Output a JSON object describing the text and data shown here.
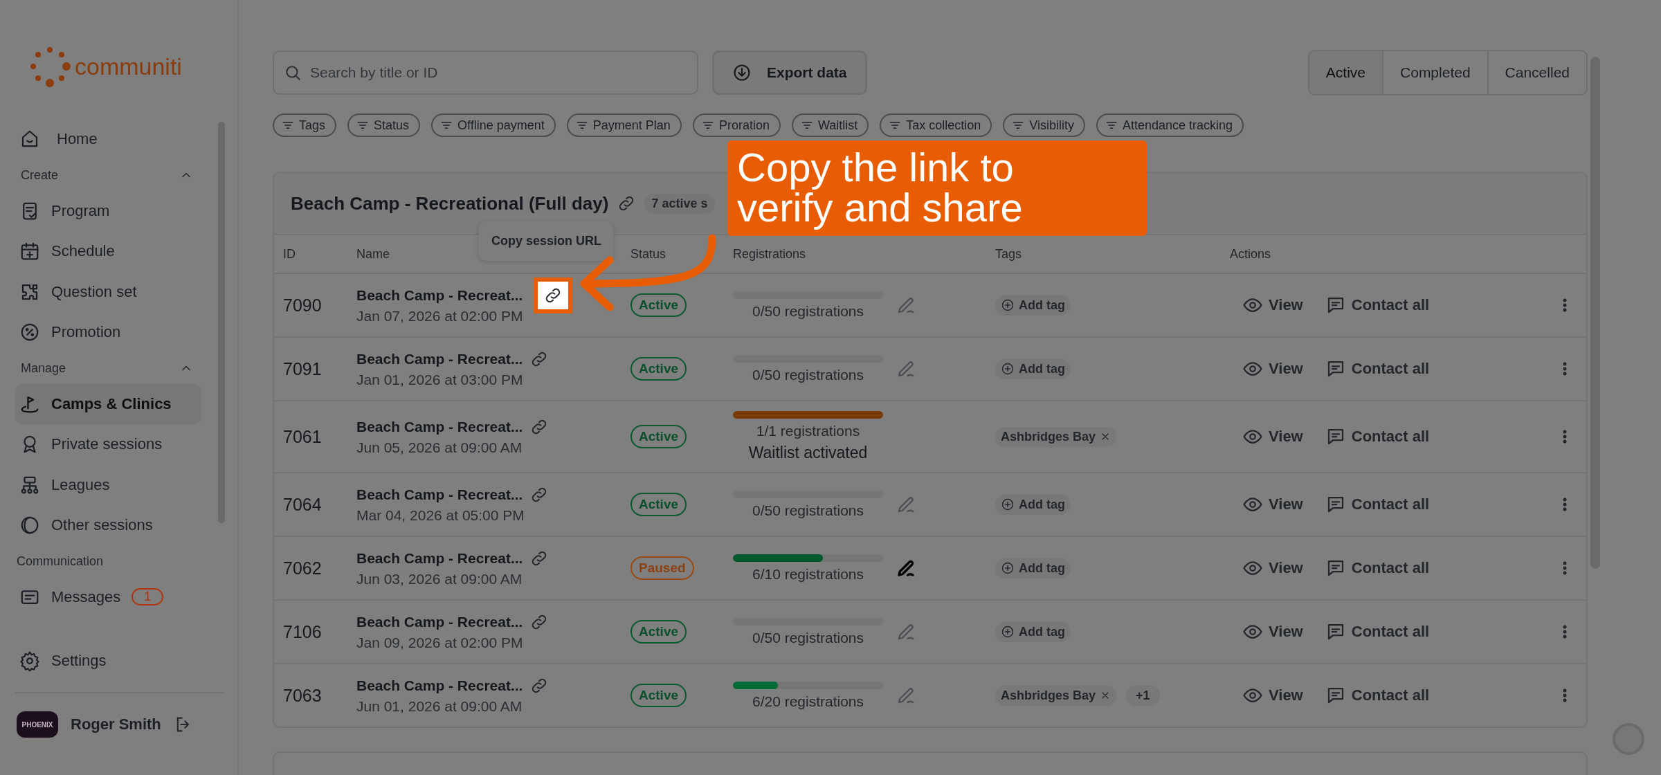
{
  "sidebar": {
    "logo": "communiti",
    "sections": [
      {
        "items": [
          {
            "label": "Home",
            "selected": false
          }
        ]
      },
      {
        "heading": "Create",
        "expanded": true,
        "items": [
          {
            "label": "Program",
            "selected": false
          },
          {
            "label": "Schedule",
            "selected": false
          },
          {
            "label": "Question set",
            "selected": false
          },
          {
            "label": "Promotion",
            "selected": false
          }
        ]
      },
      {
        "heading": "Manage",
        "expanded": true,
        "items": [
          {
            "label": "Camps & Clinics",
            "selected": true
          },
          {
            "label": "Private sessions",
            "selected": false
          },
          {
            "label": "Leagues",
            "selected": false
          },
          {
            "label": "Other sessions",
            "selected": false
          }
        ]
      },
      {
        "heading": "Communication",
        "items": [
          {
            "label": "Messages",
            "selected": false,
            "badge": "1"
          }
        ]
      }
    ],
    "settings": "Settings",
    "user": {
      "name": "Roger Smith",
      "avatar_text": "PHOENIX"
    }
  },
  "search": {
    "placeholder": "Search by title or ID"
  },
  "export_button": "Export data",
  "status_tabs": [
    {
      "label": "Active",
      "selected": true
    },
    {
      "label": "Completed",
      "selected": false
    },
    {
      "label": "Cancelled",
      "selected": false
    }
  ],
  "filters": [
    "Tags",
    "Status",
    "Offline payment",
    "Payment Plan",
    "Proration",
    "Waitlist",
    "Tax collection",
    "Visibility",
    "Attendance tracking"
  ],
  "program": {
    "title": "Beach Camp - Recreational (Full day)",
    "badge": "7 active s",
    "columns": [
      "ID",
      "Name",
      "Status",
      "Registrations",
      "Tags",
      "Actions"
    ],
    "rows": [
      {
        "id": "7090",
        "name": "Beach Camp - Recreat...",
        "date": "Jan 07, 2026 at 02:00 PM",
        "spotlight": true,
        "status": {
          "label": "Active",
          "kind": "active"
        },
        "registrations": {
          "level": 0,
          "text": "0/50 registrations",
          "editable": true,
          "edit_emphasis": false
        },
        "tags": [
          {
            "kind": "add",
            "label": "Add tag"
          }
        ],
        "view": "View",
        "contact": "Contact all"
      },
      {
        "id": "7091",
        "name": "Beach Camp - Recreat...",
        "date": "Jan 01, 2026 at 03:00 PM",
        "spotlight": false,
        "status": {
          "label": "Active",
          "kind": "active"
        },
        "registrations": {
          "level": 0,
          "text": "0/50 registrations",
          "editable": true,
          "edit_emphasis": false
        },
        "tags": [
          {
            "kind": "add",
            "label": "Add tag"
          }
        ],
        "view": "View",
        "contact": "Contact all"
      },
      {
        "id": "7061",
        "name": "Beach Camp - Recreat...",
        "date": "Jun 05, 2026 at 09:00 AM",
        "spotlight": false,
        "status": {
          "label": "Active",
          "kind": "active"
        },
        "registrations": {
          "level": 1,
          "color": "#7a3a05",
          "text": "1/1 registrations",
          "note": "Waitlist activated",
          "editable": false
        },
        "tags": [
          {
            "kind": "tag",
            "label": "Ashbridges Bay"
          }
        ],
        "view": "View",
        "contact": "Contact all"
      },
      {
        "id": "7064",
        "name": "Beach Camp - Recreat...",
        "date": "Mar 04, 2026 at 05:00 PM",
        "spotlight": false,
        "status": {
          "label": "Active",
          "kind": "active"
        },
        "registrations": {
          "level": 0,
          "text": "0/50 registrations",
          "editable": true,
          "edit_emphasis": false
        },
        "tags": [
          {
            "kind": "add",
            "label": "Add tag"
          }
        ],
        "view": "View",
        "contact": "Contact all"
      },
      {
        "id": "7062",
        "name": "Beach Camp - Recreat...",
        "date": "Jun 03, 2026 at 09:00 AM",
        "spotlight": false,
        "status": {
          "label": "Paused",
          "kind": "paused"
        },
        "registrations": {
          "level": 0.6,
          "color": "#00582c",
          "text": "6/10 registrations",
          "editable": true,
          "edit_emphasis": true
        },
        "tags": [
          {
            "kind": "add",
            "label": "Add tag"
          }
        ],
        "view": "View",
        "contact": "Contact all"
      },
      {
        "id": "7106",
        "name": "Beach Camp - Recreat...",
        "date": "Jan 09, 2026 at 02:00 PM",
        "spotlight": false,
        "status": {
          "label": "Active",
          "kind": "active"
        },
        "registrations": {
          "level": 0,
          "text": "0/50 registrations",
          "editable": true,
          "edit_emphasis": false
        },
        "tags": [
          {
            "kind": "add",
            "label": "Add tag"
          }
        ],
        "view": "View",
        "contact": "Contact all"
      },
      {
        "id": "7063",
        "name": "Beach Camp - Recreat...",
        "date": "Jun 01, 2026 at 09:00 AM",
        "spotlight": false,
        "status": {
          "label": "Active",
          "kind": "active"
        },
        "registrations": {
          "level": 0.3,
          "color": "#006b36",
          "text": "6/20 registrations",
          "editable": true,
          "edit_emphasis": false
        },
        "tags": [
          {
            "kind": "tag",
            "label": "Ashbridges Bay"
          },
          {
            "kind": "more",
            "label": "+1"
          }
        ],
        "view": "View",
        "contact": "Contact all"
      }
    ]
  },
  "tooltip": "Copy session URL",
  "callout": "Copy the link to verify and share"
}
